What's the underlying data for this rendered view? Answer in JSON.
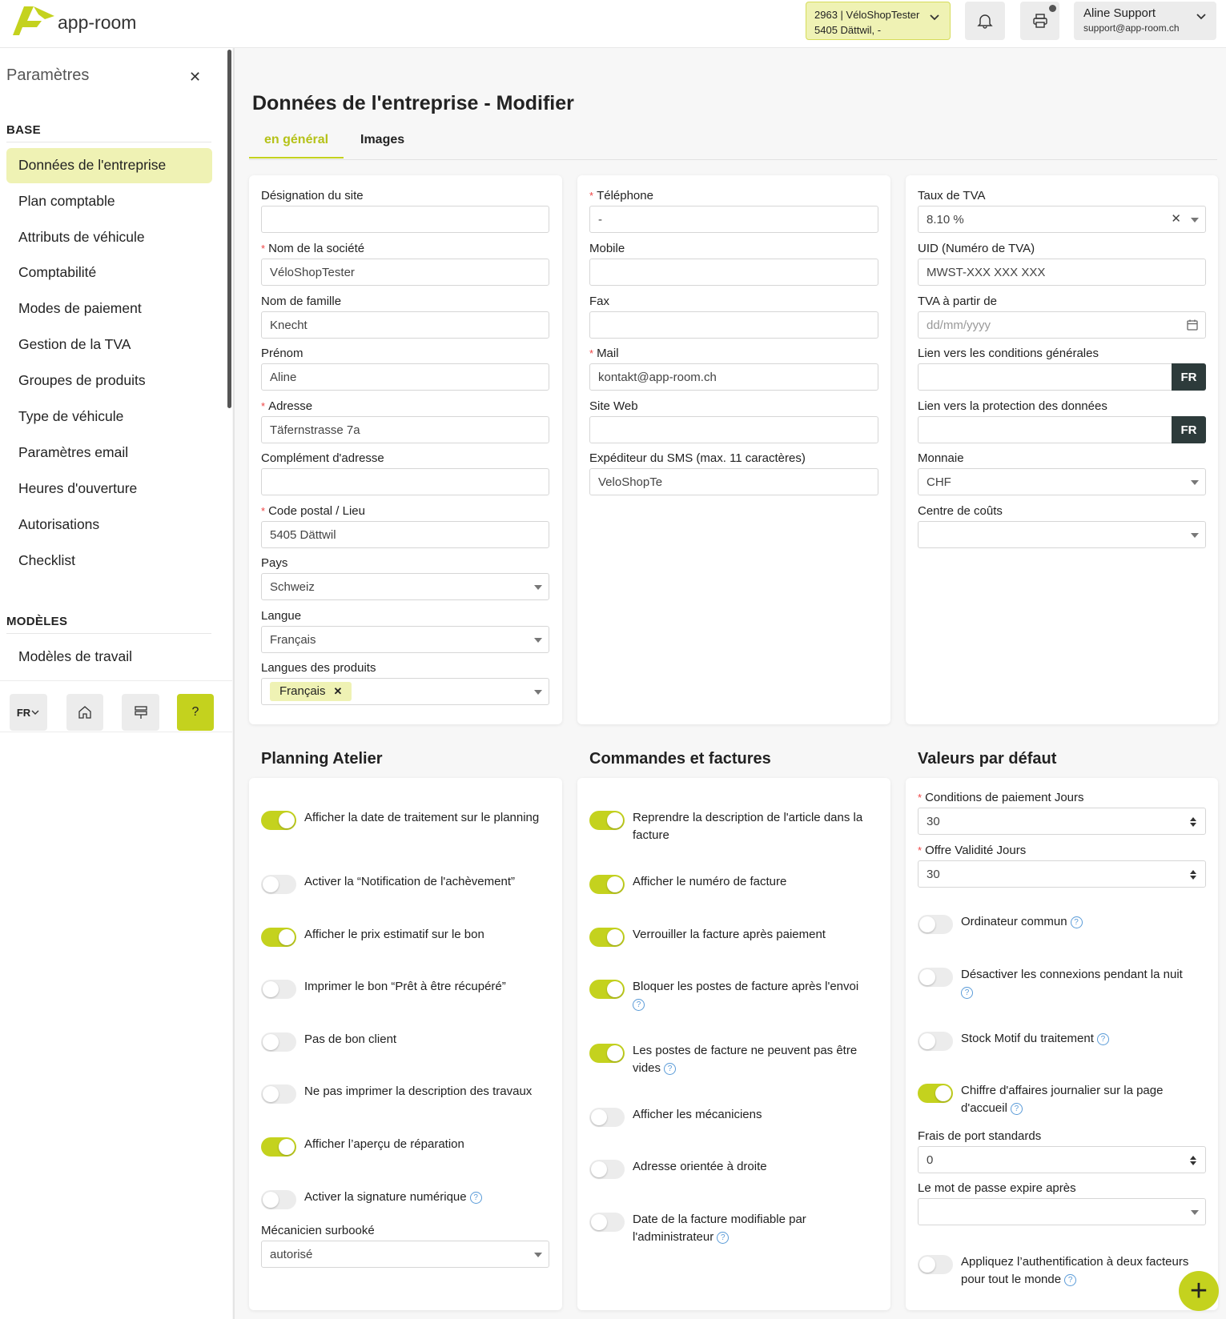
{
  "topbar": {
    "logo_text": "app-room",
    "shop_line1": "2963 | VéloShopTester",
    "shop_line2": "5405 Dättwil, -",
    "user_name": "Aline Support",
    "user_email": "support@app-room.ch"
  },
  "sidebar": {
    "title": "Paramètres",
    "section_base": "BASE",
    "items": [
      "Données de l'entreprise",
      "Plan comptable",
      "Attributs de véhicule",
      "Comptabilité",
      "Modes de paiement",
      "Gestion de la TVA",
      "Groupes de produits",
      "Type de véhicule",
      "Paramètres email",
      "Heures d'ouverture",
      "Autorisations",
      "Checklist"
    ],
    "section_models": "MODÈLES",
    "model_items": [
      "Modèles de travail"
    ],
    "lang_label": "FR",
    "help_label": "?"
  },
  "page": {
    "title": "Données de l'entreprise - Modifier",
    "tab_general": "en général",
    "tab_images": "Images"
  },
  "col1": {
    "site_label": "Désignation du site",
    "site_value": "",
    "company_label": "Nom de la société",
    "company_value": "VéloShopTester",
    "lastname_label": "Nom de famille",
    "lastname_value": "Knecht",
    "firstname_label": "Prénom",
    "firstname_value": "Aline",
    "address_label": "Adresse",
    "address_value": "Täfernstrasse 7a",
    "address2_label": "Complément d'adresse",
    "address2_value": "",
    "zip_label": "Code postal / Lieu",
    "zip_value": "5405 Dättwil",
    "country_label": "Pays",
    "country_value": "Schweiz",
    "lang_label": "Langue",
    "lang_value": "Français",
    "prodlang_label": "Langues des produits",
    "prodlang_chip": "Français"
  },
  "col2": {
    "phone_label": "Téléphone",
    "phone_value": "-",
    "mobile_label": "Mobile",
    "mobile_value": "",
    "fax_label": "Fax",
    "fax_value": "",
    "mail_label": "Mail",
    "mail_value": "kontakt@app-room.ch",
    "web_label": "Site Web",
    "web_value": "",
    "sms_label": "Expéditeur du SMS (max. 11 caractères)",
    "sms_value": "VeloShopTe"
  },
  "col3": {
    "vat_label": "Taux de TVA",
    "vat_value": "8.10 %",
    "uid_label": "UID (Numéro de TVA)",
    "uid_value": "MWST-XXX XXX XXX",
    "vat_from_label": "TVA à partir de",
    "vat_from_placeholder": "dd/mm/yyyy",
    "terms_label": "Lien vers les conditions générales",
    "fr": "FR",
    "privacy_label": "Lien vers la protection des données",
    "currency_label": "Monnaie",
    "currency_value": "CHF",
    "cost_label": "Centre de coûts",
    "cost_value": ""
  },
  "planning": {
    "title": "Planning Atelier",
    "toggles": [
      {
        "label": "Afficher la date de traitement sur le planning",
        "on": true
      },
      {
        "label": "Activer la “Notification de l'achèvement”",
        "on": false
      },
      {
        "label": "Afficher le prix estimatif sur le bon",
        "on": true
      },
      {
        "label": "Imprimer le bon “Prêt à être récupéré”",
        "on": false
      },
      {
        "label": "Pas de bon client",
        "on": false
      },
      {
        "label": "Ne pas imprimer la description des travaux",
        "on": false
      },
      {
        "label": "Afficher l’aperçu de réparation",
        "on": true
      },
      {
        "label": "Activer la signature numérique",
        "on": false
      }
    ],
    "mech_label": "Mécanicien surbooké",
    "mech_value": "autorisé"
  },
  "orders": {
    "title": "Commandes et factures",
    "toggles": [
      {
        "label": "Reprendre la description de l'article dans la facture",
        "on": true
      },
      {
        "label": "Afficher le numéro de facture",
        "on": true
      },
      {
        "label": "Verrouiller la facture après paiement",
        "on": true
      },
      {
        "label": "Bloquer les postes de facture après l'envoi",
        "on": true
      },
      {
        "label": "Les postes de facture ne peuvent pas être vides",
        "on": true
      },
      {
        "label": "Afficher les mécaniciens",
        "on": false
      },
      {
        "label": "Adresse orientée à droite",
        "on": false
      },
      {
        "label": "Date de la facture modifiable par l'administrateur",
        "on": false
      }
    ]
  },
  "defaults": {
    "title": "Valeurs par défaut",
    "pay_label": "Conditions de paiement Jours",
    "pay_value": "30",
    "offer_label": "Offre Validité Jours",
    "offer_value": "30",
    "toggles": [
      {
        "label": "Ordinateur commun",
        "on": false
      },
      {
        "label": "Désactiver les connexions pendant la nuit",
        "on": false
      },
      {
        "label": "Stock Motif du traitement",
        "on": false
      },
      {
        "label": "Chiffre d'affaires journalier sur la page d'accueil",
        "on": true
      },
      {
        "label": "Appliquez l’authentification à deux facteurs pour tout le monde",
        "on": false
      }
    ],
    "shipping_label": "Frais de port standards",
    "shipping_value": "0",
    "pwd_label": "Le mot de passe expire après",
    "pwd_value": ""
  },
  "colors": {
    "accent": "#c4d21e",
    "accent_light": "#eff2b4",
    "dark": "#2d3b3b"
  }
}
